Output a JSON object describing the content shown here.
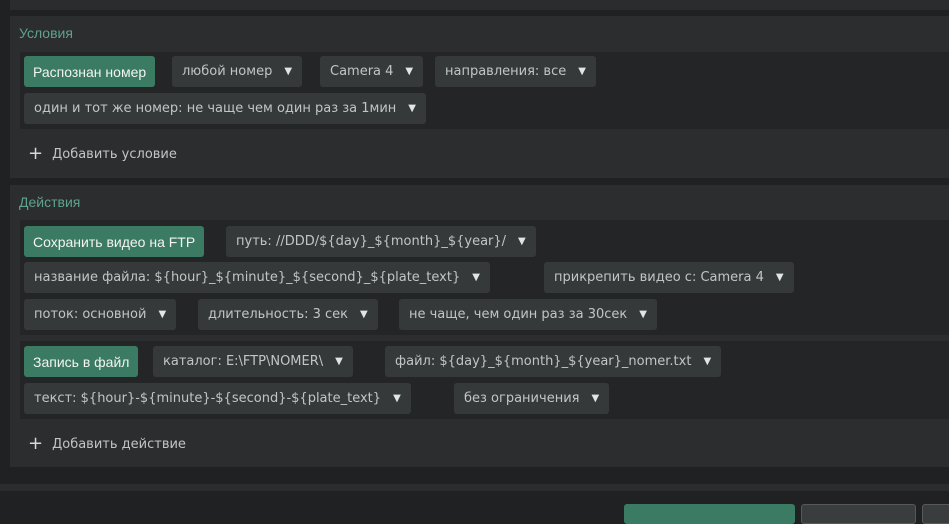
{
  "conditions": {
    "title": "Условия",
    "trigger_label": "Распознан номер",
    "params": [
      "любой номер",
      "Camera 4",
      "направления: все",
      "один и тот же номер: не чаще чем один раз за 1мин"
    ],
    "add_label": "Добавить условие"
  },
  "actions": {
    "title": "Действия",
    "ftp": {
      "label": "Сохранить видео на FTP",
      "params": [
        "путь: //DDD/${day}_${month}_${year}/",
        "название файла: ${hour}_${minute}_${second}_${plate_text}",
        "прикрепить видео с: Camera 4",
        "поток: основной",
        "длительность: 3 сек",
        "не чаще, чем один раз за 30сек"
      ]
    },
    "file": {
      "label": "Запись в файл",
      "params": [
        "каталог: E:\\FTP\\NOMER\\",
        "файл: ${day}_${month}_${year}_nomer.txt",
        "текст: ${hour}-${minute}-${second}-${plate_text}",
        "без ограничения"
      ]
    },
    "add_label": "Добавить действие"
  },
  "icons": {
    "dropdown": "▼",
    "add": "+"
  },
  "colors": {
    "accent": "#3b7a63",
    "section_title": "#5fa38c",
    "background": "#1f2122"
  }
}
